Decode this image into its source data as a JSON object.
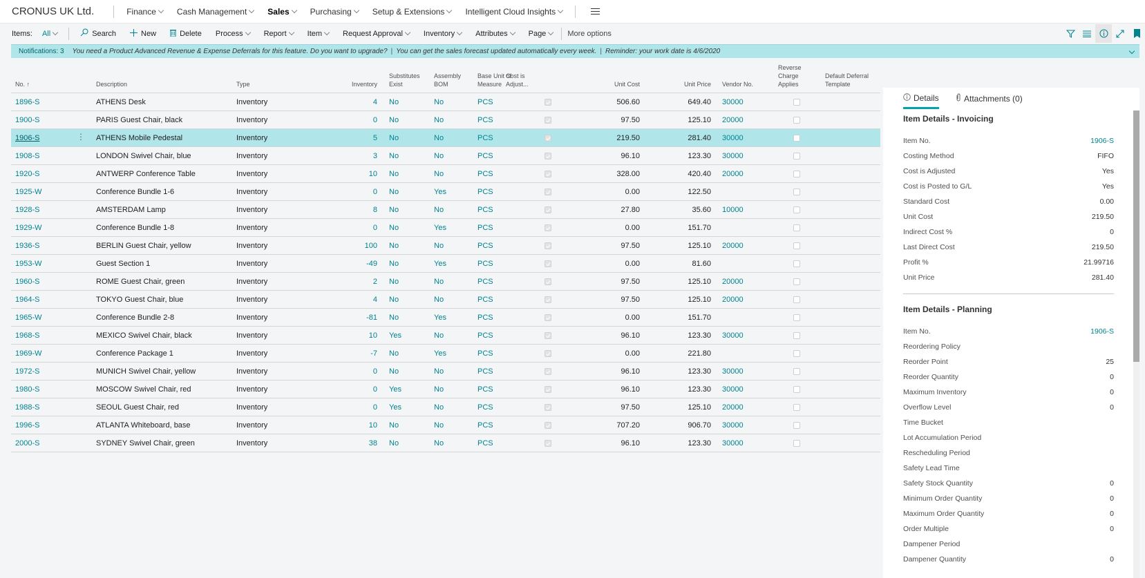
{
  "topbar": {
    "company": "CRONUS UK Ltd.",
    "nav": [
      {
        "label": "Finance",
        "dropdown": true,
        "active": false
      },
      {
        "label": "Cash Management",
        "dropdown": true,
        "active": false
      },
      {
        "label": "Sales",
        "dropdown": true,
        "active": true
      },
      {
        "label": "Purchasing",
        "dropdown": true,
        "active": false
      },
      {
        "label": "Setup & Extensions",
        "dropdown": true,
        "active": false
      },
      {
        "label": "Intelligent Cloud Insights",
        "dropdown": true,
        "active": false
      }
    ],
    "menu_icon": "hamburger-icon"
  },
  "actionbar": {
    "items_label": "Items:",
    "filter_label": "All",
    "actions": [
      {
        "label": "Search",
        "icon": "search-icon",
        "dropdown": false
      },
      {
        "label": "New",
        "icon": "plus-icon",
        "dropdown": false
      },
      {
        "label": "Delete",
        "icon": "trash-icon",
        "dropdown": false
      },
      {
        "label": "Process",
        "dropdown": true
      },
      {
        "label": "Report",
        "dropdown": true
      },
      {
        "label": "Item",
        "dropdown": true
      },
      {
        "label": "Request Approval",
        "dropdown": true
      },
      {
        "label": "Inventory",
        "dropdown": true
      },
      {
        "label": "Attributes",
        "dropdown": true
      },
      {
        "label": "Page",
        "dropdown": true
      }
    ],
    "more_options": "More options",
    "right_icons": [
      "filter-icon",
      "list-view-icon",
      "info-icon",
      "expand-icon",
      "bookmark-icon"
    ]
  },
  "notifications": {
    "count_label": "Notifications: 3",
    "messages": [
      "You need a Product Advanced Revenue & Expense Deferrals for this feature. Do you want to upgrade?",
      "You can get the sales forecast updated automatically every week.",
      "Reminder: your work date is 4/6/2020"
    ]
  },
  "grid": {
    "columns": {
      "no": "No. ↑",
      "desc": "Description",
      "type": "Type",
      "inv": "Inventory",
      "sub": [
        "Substitutes",
        "Exist"
      ],
      "bom": [
        "Assembly",
        "BOM"
      ],
      "uom": [
        "Base Unit of",
        "Measure"
      ],
      "adj": [
        "Cost is",
        "Adjust..."
      ],
      "cost": "Unit Cost",
      "price": "Unit Price",
      "vend": "Vendor No.",
      "rev": [
        "Reverse",
        "Charge",
        "Applies"
      ],
      "def": [
        "Default Deferral",
        "Template"
      ]
    },
    "selected_index": 2,
    "rows": [
      {
        "no": "1896-S",
        "desc": "ATHENS Desk",
        "type": "Inventory",
        "inv": "4",
        "sub": "No",
        "bom": "No",
        "uom": "PCS",
        "adj": true,
        "cost": "506.60",
        "price": "649.40",
        "vend": "30000",
        "rev": false,
        "def": ""
      },
      {
        "no": "1900-S",
        "desc": "PARIS Guest Chair, black",
        "type": "Inventory",
        "inv": "0",
        "sub": "No",
        "bom": "No",
        "uom": "PCS",
        "adj": true,
        "cost": "97.50",
        "price": "125.10",
        "vend": "20000",
        "rev": false,
        "def": ""
      },
      {
        "no": "1906-S",
        "desc": "ATHENS Mobile Pedestal",
        "type": "Inventory",
        "inv": "5",
        "sub": "No",
        "bom": "No",
        "uom": "PCS",
        "adj": true,
        "cost": "219.50",
        "price": "281.40",
        "vend": "30000",
        "rev": false,
        "def": ""
      },
      {
        "no": "1908-S",
        "desc": "LONDON Swivel Chair, blue",
        "type": "Inventory",
        "inv": "3",
        "sub": "No",
        "bom": "No",
        "uom": "PCS",
        "adj": true,
        "cost": "96.10",
        "price": "123.30",
        "vend": "30000",
        "rev": false,
        "def": ""
      },
      {
        "no": "1920-S",
        "desc": "ANTWERP Conference Table",
        "type": "Inventory",
        "inv": "10",
        "sub": "No",
        "bom": "No",
        "uom": "PCS",
        "adj": true,
        "cost": "328.00",
        "price": "420.40",
        "vend": "20000",
        "rev": false,
        "def": ""
      },
      {
        "no": "1925-W",
        "desc": "Conference Bundle 1-6",
        "type": "Inventory",
        "inv": "0",
        "sub": "No",
        "bom": "Yes",
        "uom": "PCS",
        "adj": true,
        "cost": "0.00",
        "price": "122.50",
        "vend": "",
        "rev": false,
        "def": ""
      },
      {
        "no": "1928-S",
        "desc": "AMSTERDAM Lamp",
        "type": "Inventory",
        "inv": "8",
        "sub": "No",
        "bom": "No",
        "uom": "PCS",
        "adj": true,
        "cost": "27.80",
        "price": "35.60",
        "vend": "10000",
        "rev": false,
        "def": ""
      },
      {
        "no": "1929-W",
        "desc": "Conference Bundle 1-8",
        "type": "Inventory",
        "inv": "0",
        "sub": "No",
        "bom": "Yes",
        "uom": "PCS",
        "adj": true,
        "cost": "0.00",
        "price": "151.70",
        "vend": "",
        "rev": false,
        "def": ""
      },
      {
        "no": "1936-S",
        "desc": "BERLIN Guest Chair, yellow",
        "type": "Inventory",
        "inv": "100",
        "sub": "No",
        "bom": "No",
        "uom": "PCS",
        "adj": true,
        "cost": "97.50",
        "price": "125.10",
        "vend": "20000",
        "rev": false,
        "def": ""
      },
      {
        "no": "1953-W",
        "desc": "Guest Section 1",
        "type": "Inventory",
        "inv": "-49",
        "sub": "No",
        "bom": "Yes",
        "uom": "PCS",
        "adj": true,
        "cost": "0.00",
        "price": "81.60",
        "vend": "",
        "rev": false,
        "def": ""
      },
      {
        "no": "1960-S",
        "desc": "ROME Guest Chair, green",
        "type": "Inventory",
        "inv": "2",
        "sub": "No",
        "bom": "No",
        "uom": "PCS",
        "adj": true,
        "cost": "97.50",
        "price": "125.10",
        "vend": "20000",
        "rev": false,
        "def": ""
      },
      {
        "no": "1964-S",
        "desc": "TOKYO Guest Chair, blue",
        "type": "Inventory",
        "inv": "4",
        "sub": "No",
        "bom": "No",
        "uom": "PCS",
        "adj": true,
        "cost": "97.50",
        "price": "125.10",
        "vend": "20000",
        "rev": false,
        "def": ""
      },
      {
        "no": "1965-W",
        "desc": "Conference Bundle 2-8",
        "type": "Inventory",
        "inv": "-81",
        "sub": "No",
        "bom": "Yes",
        "uom": "PCS",
        "adj": true,
        "cost": "0.00",
        "price": "151.70",
        "vend": "",
        "rev": false,
        "def": ""
      },
      {
        "no": "1968-S",
        "desc": "MEXICO Swivel Chair, black",
        "type": "Inventory",
        "inv": "10",
        "sub": "Yes",
        "bom": "No",
        "uom": "PCS",
        "adj": true,
        "cost": "96.10",
        "price": "123.30",
        "vend": "30000",
        "rev": false,
        "def": ""
      },
      {
        "no": "1969-W",
        "desc": "Conference Package 1",
        "type": "Inventory",
        "inv": "-7",
        "sub": "No",
        "bom": "Yes",
        "uom": "PCS",
        "adj": true,
        "cost": "0.00",
        "price": "221.80",
        "vend": "",
        "rev": false,
        "def": ""
      },
      {
        "no": "1972-S",
        "desc": "MUNICH Swivel Chair, yellow",
        "type": "Inventory",
        "inv": "0",
        "sub": "No",
        "bom": "No",
        "uom": "PCS",
        "adj": true,
        "cost": "96.10",
        "price": "123.30",
        "vend": "30000",
        "rev": false,
        "def": ""
      },
      {
        "no": "1980-S",
        "desc": "MOSCOW Swivel Chair, red",
        "type": "Inventory",
        "inv": "0",
        "sub": "Yes",
        "bom": "No",
        "uom": "PCS",
        "adj": true,
        "cost": "96.10",
        "price": "123.30",
        "vend": "30000",
        "rev": false,
        "def": ""
      },
      {
        "no": "1988-S",
        "desc": "SEOUL Guest Chair, red",
        "type": "Inventory",
        "inv": "0",
        "sub": "Yes",
        "bom": "No",
        "uom": "PCS",
        "adj": true,
        "cost": "97.50",
        "price": "125.10",
        "vend": "20000",
        "rev": false,
        "def": ""
      },
      {
        "no": "1996-S",
        "desc": "ATLANTA Whiteboard, base",
        "type": "Inventory",
        "inv": "10",
        "sub": "No",
        "bom": "No",
        "uom": "PCS",
        "adj": true,
        "cost": "707.20",
        "price": "906.70",
        "vend": "30000",
        "rev": false,
        "def": ""
      },
      {
        "no": "2000-S",
        "desc": "SYDNEY Swivel Chair, green",
        "type": "Inventory",
        "inv": "38",
        "sub": "No",
        "bom": "No",
        "uom": "PCS",
        "adj": true,
        "cost": "96.10",
        "price": "123.30",
        "vend": "30000",
        "rev": false,
        "def": ""
      }
    ]
  },
  "factbox": {
    "tabs": [
      {
        "label": "Details",
        "icon": "info-icon",
        "active": true
      },
      {
        "label": "Attachments (0)",
        "icon": "paperclip-icon",
        "active": false
      }
    ],
    "sections": [
      {
        "title": "Item Details - Invoicing",
        "fields": [
          {
            "label": "Item No.",
            "value": "1906-S",
            "link": true
          },
          {
            "label": "Costing Method",
            "value": "FIFO"
          },
          {
            "label": "Cost is Adjusted",
            "value": "Yes"
          },
          {
            "label": "Cost is Posted to G/L",
            "value": "Yes"
          },
          {
            "label": "Standard Cost",
            "value": "0.00"
          },
          {
            "label": "Unit Cost",
            "value": "219.50"
          },
          {
            "label": "Indirect Cost %",
            "value": "0"
          },
          {
            "label": "Last Direct Cost",
            "value": "219.50"
          },
          {
            "label": "Profit %",
            "value": "21.99716"
          },
          {
            "label": "Unit Price",
            "value": "281.40"
          }
        ]
      },
      {
        "title": "Item Details - Planning",
        "fields": [
          {
            "label": "Item No.",
            "value": "1906-S",
            "link": true
          },
          {
            "label": "Reordering Policy",
            "value": ""
          },
          {
            "label": "Reorder Point",
            "value": "25"
          },
          {
            "label": "Reorder Quantity",
            "value": "0"
          },
          {
            "label": "Maximum Inventory",
            "value": "0"
          },
          {
            "label": "Overflow Level",
            "value": "0"
          },
          {
            "label": "Time Bucket",
            "value": ""
          },
          {
            "label": "Lot Accumulation Period",
            "value": ""
          },
          {
            "label": "Rescheduling Period",
            "value": ""
          },
          {
            "label": "Safety Lead Time",
            "value": ""
          },
          {
            "label": "Safety Stock Quantity",
            "value": "0"
          },
          {
            "label": "Minimum Order Quantity",
            "value": "0"
          },
          {
            "label": "Maximum Order Quantity",
            "value": "0"
          },
          {
            "label": "Order Multiple",
            "value": "0"
          },
          {
            "label": "Dampener Period",
            "value": ""
          },
          {
            "label": "Dampener Quantity",
            "value": "0"
          }
        ]
      }
    ]
  },
  "colors": {
    "accent": "#00838f",
    "selected_row": "#b0e6ea",
    "notification_bg": "#b0e6ea",
    "tab_underline": "#00a2ad"
  }
}
